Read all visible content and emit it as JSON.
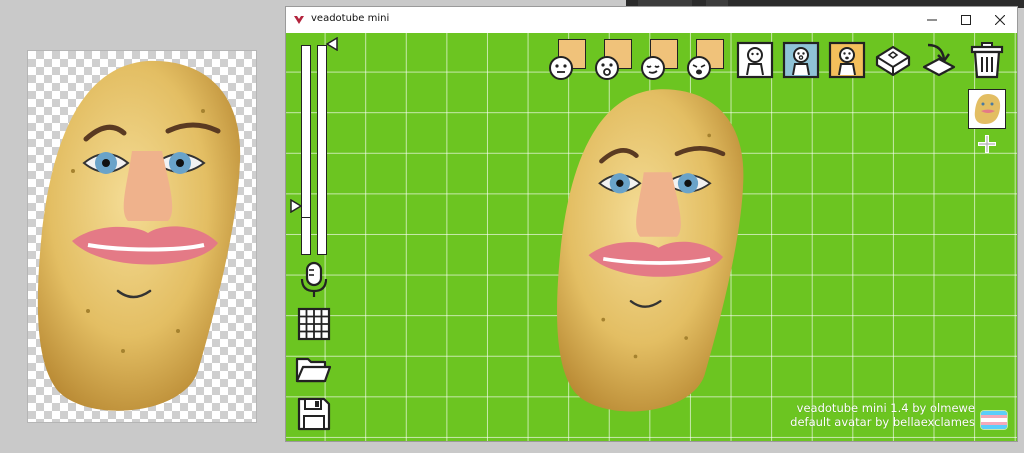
{
  "window": {
    "title": "veadotube mini"
  },
  "credits": {
    "line1": "veadotube mini 1.4 by olmewe",
    "line2": "default avatar by bellaexclames"
  },
  "colors": {
    "stage_green": "#6cc521",
    "flag": [
      "#5bcefa",
      "#f5a9b8",
      "#ffffff",
      "#f5a9b8",
      "#5bcefa"
    ]
  },
  "toolbar": {
    "state_icons": [
      "face-neutral-icon",
      "face-surprised-icon",
      "face-sleepy-icon",
      "face-shout-icon"
    ],
    "tool_icons": [
      "mic-off-pose-icon",
      "talking-pose-icon",
      "alert-pose-icon",
      "hotkey-icon",
      "import-icon",
      "trash-icon"
    ]
  },
  "sidebar": {
    "icons": [
      "microphone-icon",
      "grid-icon",
      "open-folder-icon",
      "save-icon"
    ]
  }
}
